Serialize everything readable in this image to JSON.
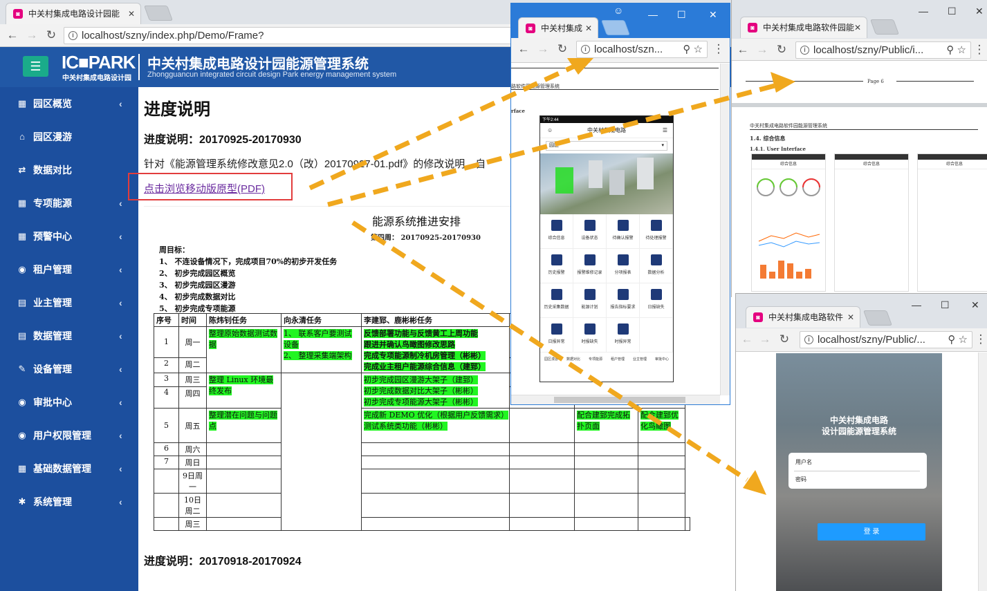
{
  "main": {
    "tab_title": "中关村集成电路设计园能",
    "url": "localhost/szny/index.php/Demo/Frame?",
    "logo": "IC■PARK",
    "logo_sub": "中关村集成电路设计园",
    "system_title": "中关村集成电路设计园能源管理系统",
    "system_title_en": "Zhongguancun integrated circuit design Park energy management system",
    "sidebar": [
      {
        "label": "园区概览",
        "icon": "db-icon"
      },
      {
        "label": "园区漫游",
        "icon": "bank-icon"
      },
      {
        "label": "数据对比",
        "icon": "exchange-icon"
      },
      {
        "label": "专项能源",
        "icon": "db-icon"
      },
      {
        "label": "预警中心",
        "icon": "db-icon"
      },
      {
        "label": "租户管理",
        "icon": "user-icon"
      },
      {
        "label": "业主管理",
        "icon": "book-icon"
      },
      {
        "label": "数据管理",
        "icon": "book-icon"
      },
      {
        "label": "设备管理",
        "icon": "wrench-icon"
      },
      {
        "label": "审批中心",
        "icon": "user-icon"
      },
      {
        "label": "用户权限管理",
        "icon": "user-icon"
      },
      {
        "label": "基础数据管理",
        "icon": "db-icon"
      },
      {
        "label": "系统管理",
        "icon": "gear-icon"
      }
    ],
    "page_title": "进度说明",
    "section1": "进度说明：20170925-20170930",
    "paragraph": "针对《能源管理系统修改意见2.0（改）20170927-01.pdf》的修改说明，自",
    "pdf_link": "点击浏览移动版原型(PDF)",
    "section2": "进度说明：20170918-20170924",
    "doc": {
      "title": "能源系统推进安排",
      "week": "第四周： 20170925-20170930",
      "goals_title": "周目标：",
      "goals": [
        "1、 不连设备情况下，完成项目70%的初步开发任务",
        "2、 初步完成园区概览",
        "3、 初步完成园区漫游",
        "4、 初步完成数据对比",
        "5、 初步完成专项能源"
      ],
      "headers": [
        "序号",
        "时间",
        "陈炜钊任务",
        "向永清任务",
        "李建郅、鹿彬彬任务"
      ],
      "rows": [
        {
          "no": "1",
          "day": "周一"
        },
        {
          "no": "2",
          "day": "周二"
        },
        {
          "no": "3",
          "day": "周三"
        },
        {
          "no": "4",
          "day": "周四"
        },
        {
          "no": "5",
          "day": "周五"
        },
        {
          "no": "6",
          "day": "周六"
        },
        {
          "no": "7",
          "day": "周日"
        },
        {
          "no": "",
          "day": "9日周一"
        },
        {
          "no": "",
          "day": "10日周二"
        },
        {
          "no": "",
          "day": "周三"
        }
      ],
      "chen_tasks": [
        "整理原始数据测试数据",
        "整理 Linux 环境最终发布",
        "整理潜在问题与问题点"
      ],
      "xiang_tasks": [
        "1、 联系客户要测试设备",
        "2、 整理采集端架构"
      ],
      "li_tasks_mon": [
        "反馈部署功能与反馈黄工上周功能",
        "跟进并确认鸟瞰图修改思路",
        "完成专项能源制冷机房管理（彬彬）",
        "完成业主租户能源综合信息（建郅）"
      ],
      "li_tasks_wed": [
        "初步完成园区漫游大架子（建郅）",
        "初步完成数据对比大架子（彬彬）",
        "初步完成专项能源大架子（彬彬）"
      ],
      "li_tasks_fri": [
        "完成新 DEMO 优化（根据用户反馈需求）",
        "测试系统类功能（彬彬）"
      ],
      "extra_col1": "配合建郅完成拓扑页面",
      "extra_col2": "配合建郅优化鸟瞰图"
    }
  },
  "mobile": {
    "tab_title": "中关村集成",
    "url": "localhost/szn...",
    "doc_head": "路软件园能源管理系统",
    "doc_sub": "rface",
    "status": "下午2:44",
    "app_title": "中关村集成电路",
    "select": "园区",
    "grid": [
      "综合信息",
      "设备状态",
      "待确认报警",
      "待处理报警",
      "历史报警",
      "报警维修记录",
      "分项报表",
      "数据分析",
      "历史采集数据",
      "能源计划",
      "报告指标要求",
      "日报缺失",
      "日报异常",
      "时报缺失",
      "时报异常",
      ""
    ],
    "bottom_nav": [
      "园区漫游",
      "数据对比",
      "专项能源",
      "租户管理",
      "业主管理",
      "审批中心"
    ]
  },
  "pdf": {
    "tab_title": "中关村集成电路软件园能",
    "url": "localhost/szny/Public/i...",
    "page_label": "Page 6",
    "doc_head": "中关村集成电路软件园能源管理系统",
    "section": "1.4. 综合信息",
    "subsection": "1.4.1. User Interface",
    "phone_titles": [
      "综合信息",
      "综合信息",
      "综合信息"
    ]
  },
  "login": {
    "tab_title": "中关村集成电路软件",
    "url": "localhost/szny/Public/...",
    "title1": "中关村集成电路",
    "title2": "设计园能源管理系统",
    "username": "用户名",
    "password": "密码",
    "submit": "登 录"
  },
  "colors": {
    "header_blue": "#2158a6",
    "sidebar_blue": "#1c4f9e",
    "highlight_green": "#22f522",
    "arrow_orange": "#f0a81e",
    "login_button": "#1e9bff"
  }
}
